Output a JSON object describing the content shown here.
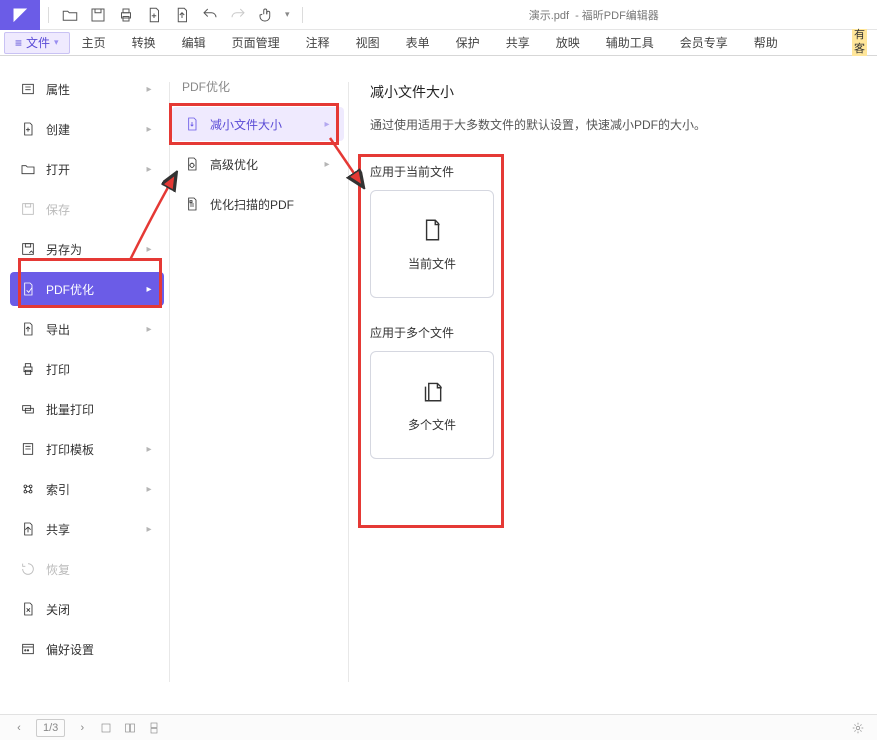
{
  "window": {
    "doc_title": "演示.pdf",
    "app_title": "- 福昕PDF编辑器"
  },
  "ribbon": {
    "file_label": "文件",
    "tabs": [
      "主页",
      "转换",
      "编辑",
      "页面管理",
      "注释",
      "视图",
      "表单",
      "保护",
      "共享",
      "放映",
      "辅助工具",
      "会员专享",
      "帮助"
    ],
    "right1": "有",
    "right2": "客"
  },
  "filemenu": {
    "items": [
      {
        "label": "属性",
        "arrow": true
      },
      {
        "label": "创建",
        "arrow": true
      },
      {
        "label": "打开",
        "arrow": true
      },
      {
        "label": "保存",
        "arrow": false,
        "disabled": true
      },
      {
        "label": "另存为",
        "arrow": true
      },
      {
        "label": "PDF优化",
        "arrow": true,
        "active": true
      },
      {
        "label": "导出",
        "arrow": true
      },
      {
        "label": "打印",
        "arrow": false
      },
      {
        "label": "批量打印",
        "arrow": false
      },
      {
        "label": "打印模板",
        "arrow": true
      },
      {
        "label": "索引",
        "arrow": true
      },
      {
        "label": "共享",
        "arrow": true
      },
      {
        "label": "恢复",
        "arrow": false,
        "disabled": true
      },
      {
        "label": "关闭",
        "arrow": false
      },
      {
        "label": "偏好设置",
        "arrow": false
      }
    ]
  },
  "submenu": {
    "header": "PDF优化",
    "items": [
      {
        "label": "减小文件大小",
        "arrow": true,
        "active": true
      },
      {
        "label": "高级优化",
        "arrow": true
      },
      {
        "label": "优化扫描的PDF",
        "arrow": false
      }
    ]
  },
  "detail": {
    "title": "减小文件大小",
    "desc": "通过使用适用于大多数文件的默认设置，快速减小PDF的大小。",
    "section1": "应用于当前文件",
    "card1": "当前文件",
    "section2": "应用于多个文件",
    "card2": "多个文件"
  },
  "status": {
    "page": "1/3"
  }
}
